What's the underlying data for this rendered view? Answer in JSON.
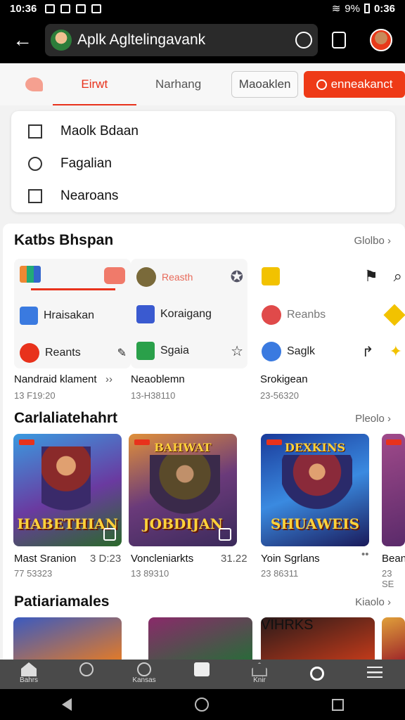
{
  "status": {
    "time": "10:36",
    "battery": "9%",
    "clock_right": "0:36"
  },
  "search": {
    "query": "Aplk Agltelingavank"
  },
  "tabs": [
    {
      "label": "Eirwt",
      "active": true
    },
    {
      "label": "Narhang",
      "active": false
    }
  ],
  "header_buttons": {
    "outline": "Maoaklen",
    "primary": "enneakanct"
  },
  "menu": {
    "items": [
      {
        "label": "Maolk Bdaan",
        "icon": "list-icon"
      },
      {
        "label": "Fagalian",
        "icon": "clock-icon"
      },
      {
        "label": "Nearoans",
        "icon": "bag-icon"
      }
    ]
  },
  "section1": {
    "title": "Katbs Bhspan",
    "more": "Glolbo"
  },
  "categories": [
    {
      "top": "",
      "rows": [
        "Hraisakan",
        "Reants"
      ],
      "title": "Nandraid klament",
      "sub": "13 F19:20"
    },
    {
      "top": "Reasth",
      "rows": [
        "Koraigang",
        "Sgaia"
      ],
      "title": "Neaoblemn",
      "sub": "13-H38110"
    },
    {
      "top": "",
      "rows": [
        "Reanbs",
        "Saglk"
      ],
      "title": "Srokigean",
      "sub": "23-56320"
    }
  ],
  "section2": {
    "title": "Carlaliatehahrt",
    "more": "Pleolo"
  },
  "games": [
    {
      "top_text": "",
      "art_text": "HABETHIAN",
      "title": "Mast Sranion",
      "price": "3 D:23",
      "sub": "77 53323"
    },
    {
      "top_text": "BAHWAT",
      "art_text": "JOBDIJAN",
      "title": "Voncleniarkts",
      "price": "31.22",
      "sub": "13 89310"
    },
    {
      "top_text": "DEXKINS",
      "art_text": "SHUAWEIS",
      "title": "Yoin Sgrlans",
      "price": "",
      "sub": "23 86311"
    },
    {
      "top_text": "",
      "art_text": "",
      "title": "Bean",
      "price": "",
      "sub": "23 SE"
    }
  ],
  "section3": {
    "title": "Patiariamales",
    "more": "Kiaolo"
  },
  "row3": [
    {
      "art_text": ""
    },
    {
      "art_text": ""
    },
    {
      "art_text": "VIHRKS"
    },
    {
      "art_text": ""
    }
  ],
  "nav": [
    {
      "label": "Bahrs",
      "icon": "home-icon"
    },
    {
      "label": "",
      "icon": "search-icon"
    },
    {
      "label": "Kansas",
      "icon": "badge-icon"
    },
    {
      "label": "",
      "icon": "tag-icon"
    },
    {
      "label": "Knir",
      "icon": "house-icon"
    },
    {
      "label": "",
      "icon": "search-icon"
    },
    {
      "label": "",
      "icon": "menu-icon"
    }
  ]
}
